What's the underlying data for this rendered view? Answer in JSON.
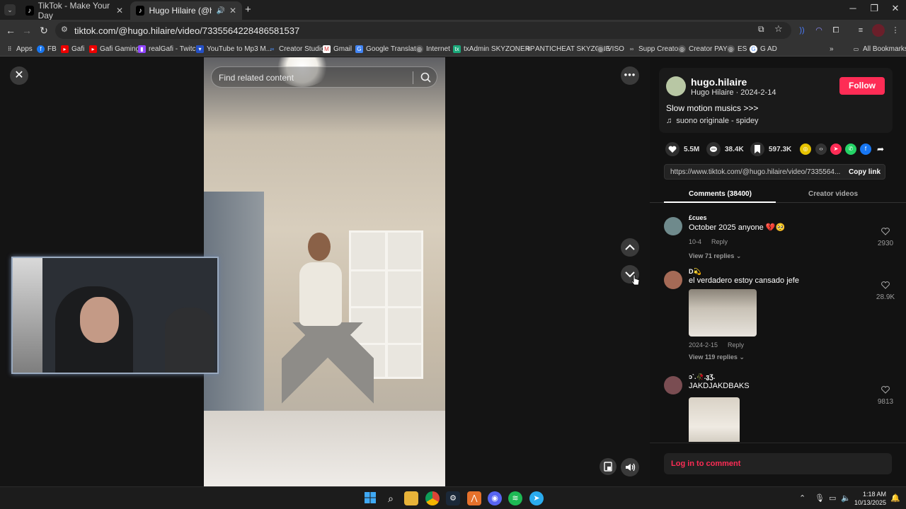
{
  "browser": {
    "tabs": [
      {
        "title": "TikTok - Make Your Day",
        "active": false
      },
      {
        "title": "Hugo Hilaire (@hugo.hilaire",
        "active": true
      }
    ],
    "url": "tiktok.com/@hugo.hilaire/video/7335564228486581537",
    "bookmarks": [
      "Apps",
      "FB",
      "Gafi",
      "Gafi Gaming",
      "realGafi - Twitch",
      "YouTube to Mp3 M...",
      "Creator Studio",
      "Gmail",
      "Google Translate",
      "Internet",
      "txAdmin SKYZONERP",
      "ANTICHEAT SKYZONE",
      "VISO",
      "Supp Creator",
      "Creator PAY",
      "ES",
      "G AD"
    ],
    "all_bookmarks": "All Bookmarks"
  },
  "viewer": {
    "search_placeholder": "Find related content"
  },
  "panel": {
    "username": "hugo.hilaire",
    "subline": "Hugo Hilaire · 2024-2-14",
    "follow": "Follow",
    "caption": "Slow motion musics >>>",
    "sound": "suono originale - spidey",
    "likes": "5.5M",
    "comments_count": "38.4K",
    "saves": "597.3K",
    "link": "https://www.tiktok.com/@hugo.hilaire/video/7335564...",
    "copy_link": "Copy link",
    "tab_comments": "Comments (38400)",
    "tab_creator": "Creator videos",
    "comments": [
      {
        "name": "£cues",
        "text": "October 2025 anyone 💔🥺",
        "date": "10-4",
        "reply": "Reply",
        "replies": "View 71 replies ⌄",
        "likes": "2930"
      },
      {
        "name": "D💫",
        "text": "el verdadero estoy cansado jefe",
        "date": "2024-2-15",
        "reply": "Reply",
        "replies": "View 119 replies ⌄",
        "likes": "28.9K"
      },
      {
        "name": "ↄ`.🥀.ჳƷ.",
        "text": "JAKDJAKDBAKS",
        "likes": "9813"
      }
    ],
    "login": "Log in to comment"
  },
  "taskbar": {
    "time": "1:18 AM",
    "date": "10/13/2025"
  },
  "colors": {
    "accent": "#fe2c55",
    "background": "#121212"
  }
}
